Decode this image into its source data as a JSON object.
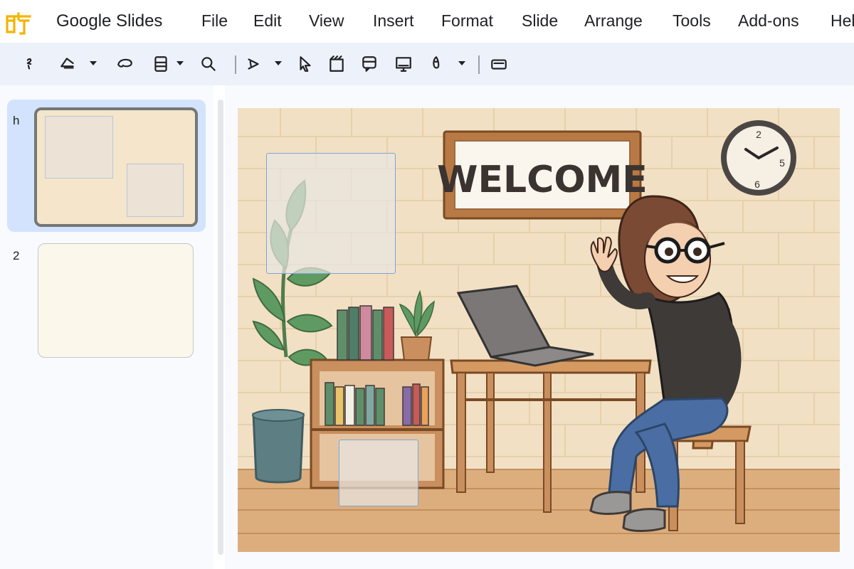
{
  "app": {
    "title": "Google Slides",
    "logo_icon": "slides-logo-icon",
    "accent": "#f4b400"
  },
  "menu": [
    {
      "label": "File"
    },
    {
      "label": "Edit"
    },
    {
      "label": "View"
    },
    {
      "label": "Insert"
    },
    {
      "label": "Format"
    },
    {
      "label": "Slide"
    },
    {
      "label": "Arrange"
    },
    {
      "label": "Tools"
    },
    {
      "label": "Add-ons"
    },
    {
      "label": "Help"
    }
  ],
  "toolbar": {
    "icons": [
      "paint-format-icon",
      "shape-icon",
      "lasso-icon",
      "layout-icon",
      "search-icon",
      "line-icon",
      "select-arrow-icon",
      "clapper-icon",
      "comment-icon",
      "present-icon",
      "brush-icon",
      "caption-icon",
      "more-vert-icon"
    ]
  },
  "filmstrip": {
    "slides": [
      {
        "number": "h",
        "selected": true
      },
      {
        "number": "2",
        "selected": false
      }
    ]
  },
  "slide": {
    "sign_text": "WELCOME",
    "clock_numbers": [
      "2",
      "5",
      "6"
    ],
    "colors": {
      "wall": "#f1dfc3",
      "floor": "#d9a978",
      "selection": "#7ea6d8"
    }
  }
}
